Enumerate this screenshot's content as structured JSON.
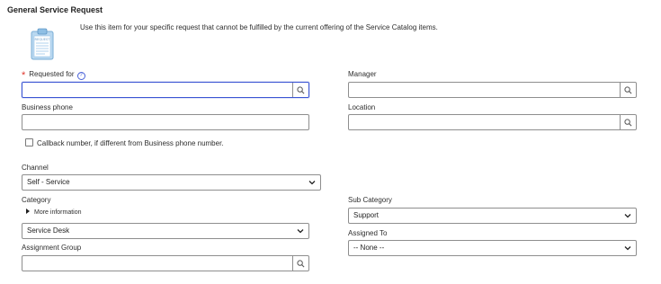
{
  "form": {
    "title": "General Service Request",
    "description": "Use this item for your specific request that cannot be fulfilled by the current offering of the Service Catalog items.",
    "icon_caption": "REQUEST"
  },
  "fields": {
    "requested_for": {
      "label": "Requested for",
      "value": "",
      "required": true
    },
    "manager": {
      "label": "Manager",
      "value": ""
    },
    "business_phone": {
      "label": "Business phone",
      "value": ""
    },
    "location": {
      "label": "Location",
      "value": ""
    },
    "callback": {
      "label": "Callback number, if different from Business phone number.",
      "checked": false
    },
    "channel": {
      "label": "Channel",
      "selected": "Self - Service"
    },
    "category": {
      "label": "Category",
      "more_info": "More information",
      "selected": "Service Desk"
    },
    "sub_category": {
      "label": "Sub Category",
      "selected": "Support"
    },
    "assigned_to": {
      "label": "Assigned To",
      "selected": "-- None --"
    },
    "assignment_group": {
      "label": "Assignment Group",
      "value": ""
    }
  },
  "colors": {
    "focus_border": "#3b55d3",
    "required_star": "#e0352c",
    "border": "#8e8e8e"
  },
  "icons": [
    "clipboard-icon",
    "help-icon",
    "search-icon",
    "chevron-down-icon",
    "triangle-right-icon"
  ]
}
